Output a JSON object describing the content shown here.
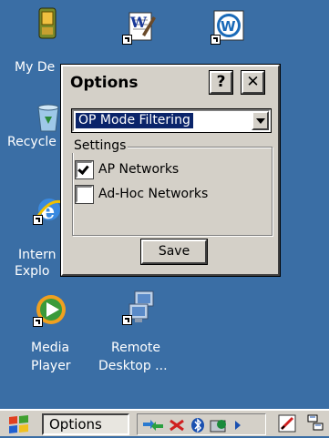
{
  "desktop": {
    "icons": [
      {
        "name": "my-device",
        "label": "My De"
      },
      {
        "name": "recycle-bin",
        "label": "Recycle"
      },
      {
        "name": "internet-explorer",
        "label_line1": "Intern",
        "label_line2": "Explo"
      },
      {
        "name": "media-player",
        "label_line1": "Media",
        "label_line2": "Player"
      },
      {
        "name": "remote-desktop",
        "label_line1": "Remote",
        "label_line2": "Desktop ..."
      }
    ]
  },
  "dialog": {
    "title": "Options",
    "help_label": "?",
    "close_label": "✕",
    "dropdown": {
      "selected": "OP Mode Filtering"
    },
    "settings_group": {
      "title": "Settings",
      "items": [
        {
          "label": "AP Networks",
          "checked": true
        },
        {
          "label": "Ad-Hoc Networks",
          "checked": false
        }
      ]
    },
    "save_label": "Save"
  },
  "taskbar": {
    "active_task": "Options",
    "tray_icons": [
      "network-arrows-icon",
      "bluetooth-x-icon",
      "bluetooth-icon",
      "wifi-status-icon",
      "arrow-right-icon"
    ],
    "right_icons": [
      "pen-edit-icon",
      "desktop-switch-icon"
    ]
  },
  "colors": {
    "desktop": "#3a6ea5",
    "dialog_face": "#d4d0c8",
    "selection": "#0a246a"
  }
}
